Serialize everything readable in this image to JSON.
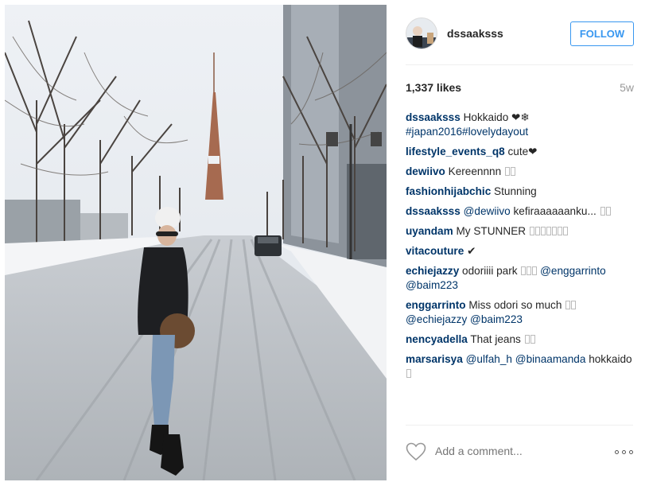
{
  "post": {
    "username": "dssaaksss",
    "follow_label": "FOLLOW",
    "likes": "1,337 likes",
    "age": "5w",
    "add_comment_placeholder": "Add a comment..."
  },
  "comments": [
    {
      "user": "dssaaksss",
      "text": "Hokkaido ❤❄",
      "tags": "#japan2016#lovelydayout"
    },
    {
      "user": "lifestyle_events_q8",
      "text": "cute❤"
    },
    {
      "user": "dewiivo",
      "text": "Kereennnn",
      "boxes": 2
    },
    {
      "user": "fashionhijabchic",
      "text": "Stunning"
    },
    {
      "user": "dssaaksss",
      "mention": "@dewiivo",
      "text": "kefiraaaaaanku...",
      "boxes": 2
    },
    {
      "user": "uyandam",
      "text": "My STUNNER",
      "boxes": 7
    },
    {
      "user": "vitacouture",
      "text": "✔"
    },
    {
      "user": "echiejazzy",
      "text": "odoriiii park",
      "boxes": 3,
      "mention": "@enggarrinto @baim223"
    },
    {
      "user": "enggarrinto",
      "text": "Miss odori so much",
      "mention": "@echiejazzy @baim223",
      "boxes": 2
    },
    {
      "user": "nencyadella",
      "text": "That jeans",
      "boxes": 2
    },
    {
      "user": "marsarisya",
      "mention": "@ulfah_h @binaamanda",
      "text": "hokkaido",
      "boxes": 1
    }
  ],
  "colors": {
    "link": "#003569",
    "accent": "#3897f0",
    "muted": "#999999"
  },
  "icons": {
    "like": "heart-icon",
    "more": "more-options-icon"
  }
}
